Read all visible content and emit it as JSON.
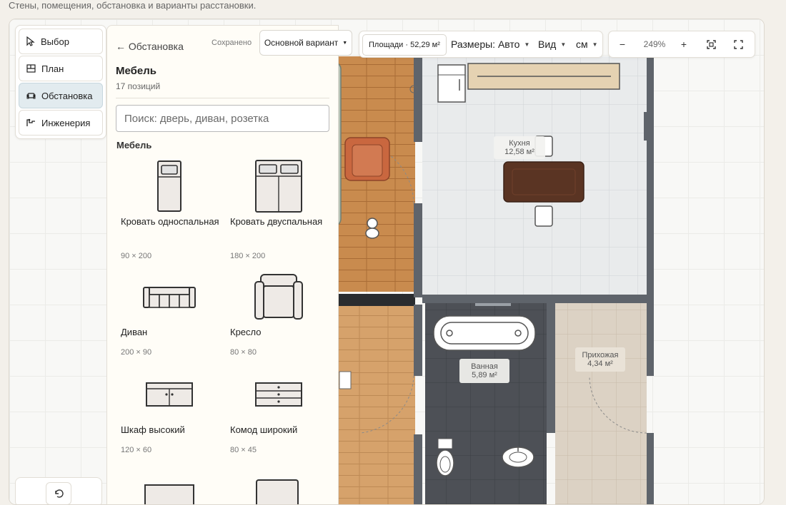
{
  "subtitle": "Стены, помещения, обстановка и варианты расстановки.",
  "tools": [
    {
      "label": "Выбор",
      "icon": "cursor-icon",
      "active": false
    },
    {
      "label": "План",
      "icon": "plan-icon",
      "active": false
    },
    {
      "label": "Обстановка",
      "icon": "furniture-icon",
      "active": true
    },
    {
      "label": "Инженерия",
      "icon": "engineering-icon",
      "active": false
    }
  ],
  "panel": {
    "back_label": "← Обстановка",
    "saved_label": "Сохранено",
    "title": "Мебель",
    "count": "17 позиций",
    "search_placeholder": "Поиск: дверь, диван, розетка",
    "section": "Мебель",
    "items": [
      {
        "name": "Кровать односпальная",
        "size": "90 × 200",
        "icon": "single-bed-icon"
      },
      {
        "name": "Кровать двуспальная",
        "size": "180 × 200",
        "icon": "double-bed-icon"
      },
      {
        "name": "Диван",
        "size": "200 × 90",
        "icon": "sofa-icon"
      },
      {
        "name": "Кресло",
        "size": "80 × 80",
        "icon": "armchair-icon"
      },
      {
        "name": "Шкаф высокий",
        "size": "120 × 60",
        "icon": "wardrobe-icon"
      },
      {
        "name": "Комод широкий",
        "size": "80 × 45",
        "icon": "chest-of-drawers-icon"
      }
    ]
  },
  "topbar": {
    "variant": "Основной вариант",
    "area": "Площади · 52,29 м²",
    "dimensions": "Размеры: Авто",
    "view": "Вид",
    "units": "см",
    "zoom": "249%",
    "zoom_out": "−",
    "zoom_in": "+"
  },
  "rooms": [
    {
      "name": "Кухня",
      "area": "12,58 м²"
    },
    {
      "name": "Ванная",
      "area": "5,89 м²"
    },
    {
      "name": "Прихожая",
      "area": "4,34 м²"
    }
  ],
  "colors": {
    "wall": "#5f646b",
    "wood": "#c78a4e",
    "tile_dark": "#4d5056",
    "tile_light": "#e9ebec",
    "accent_active": "#e2ebef",
    "table": "#5a3423",
    "armchair": "#c9673f"
  }
}
